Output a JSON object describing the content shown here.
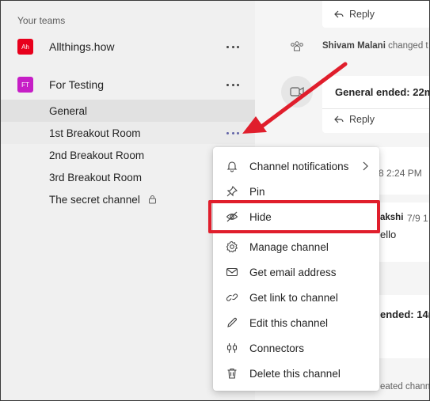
{
  "sidebar": {
    "section_label": "Your teams",
    "teams": [
      {
        "initials": "Ah",
        "name": "Allthings.how",
        "color": "#e8001c"
      },
      {
        "initials": "FT",
        "name": "For Testing",
        "color": "#c61ec6"
      }
    ],
    "channels": [
      {
        "name": "General",
        "state": "selected"
      },
      {
        "name": "1st Breakout Room",
        "state": "hover"
      },
      {
        "name": "2nd Breakout Room",
        "state": "normal"
      },
      {
        "name": "3rd Breakout Room",
        "state": "normal"
      },
      {
        "name": "The secret channel",
        "state": "normal",
        "private": true
      }
    ]
  },
  "chat": {
    "reply_label": "Reply",
    "system_message": {
      "author": "Shivam Malani",
      "text": "changed t"
    },
    "meeting_ended_1": "General ended: 22m",
    "timestamp_1": "8 2:24 PM",
    "author_partial": "akshi",
    "timestamp_2": "7/9 1",
    "message_partial": "ello",
    "meeting_ended_2": "ended: 14m",
    "footer_partial": "eated chann"
  },
  "context_menu": {
    "items": [
      {
        "label": "Channel notifications",
        "icon": "bell-icon",
        "submenu": true
      },
      {
        "label": "Pin",
        "icon": "pin-icon"
      },
      {
        "label": "Hide",
        "icon": "eye-off-icon",
        "highlighted": true
      },
      {
        "label": "Manage channel",
        "icon": "gear-icon"
      },
      {
        "label": "Get email address",
        "icon": "mail-icon"
      },
      {
        "label": "Get link to channel",
        "icon": "link-icon"
      },
      {
        "label": "Edit this channel",
        "icon": "pencil-icon"
      },
      {
        "label": "Connectors",
        "icon": "plug-icon"
      },
      {
        "label": "Delete this channel",
        "icon": "trash-icon"
      }
    ]
  },
  "colors": {
    "annotation_red": "#e01e2c",
    "accent": "#6264a7"
  }
}
